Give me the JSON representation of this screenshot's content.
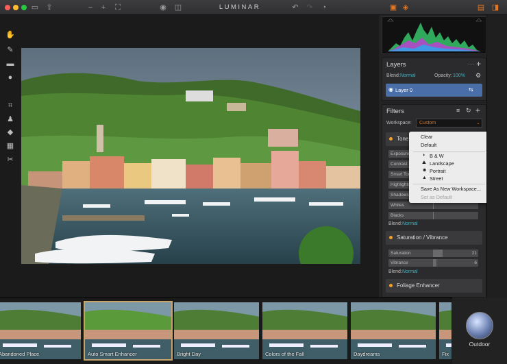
{
  "app": {
    "title": "LUMINAR"
  },
  "layers": {
    "title": "Layers",
    "blend_label": "Blend:",
    "blend_value": "Normal",
    "opacity_label": "Opacity:",
    "opacity_value": "100%",
    "layer_name": "Layer 0"
  },
  "filters": {
    "title": "Filters",
    "workspace_label": "Workspace:",
    "workspace_value": "Custom",
    "tone": {
      "title": "Tone",
      "rows": [
        "Exposure",
        "Contrast",
        "Smart Tone",
        "Highlights",
        "Shadows",
        "Whites",
        "Blacks"
      ],
      "blend_label": "Blend:",
      "blend_value": "Normal"
    },
    "saturation": {
      "title": "Saturation / Vibrance",
      "saturation_label": "Saturation",
      "saturation_value": "21",
      "vibrance_label": "Vibrance",
      "vibrance_value": "6",
      "blend_label": "Blend:",
      "blend_value": "Normal"
    },
    "foliage": {
      "title": "Foliage Enhancer"
    }
  },
  "workspace_menu": {
    "items": [
      {
        "label": "Clear",
        "enabled": true
      },
      {
        "label": "Default",
        "enabled": true
      },
      {
        "label": "B & W",
        "enabled": true,
        "icon": "half-circle-icon"
      },
      {
        "label": "Landscape",
        "enabled": true,
        "icon": "mountain-icon"
      },
      {
        "label": "Portrait",
        "enabled": true,
        "icon": "face-icon"
      },
      {
        "label": "Street",
        "enabled": true,
        "icon": "building-icon"
      },
      {
        "label": "Save As New Workspace...",
        "enabled": true
      },
      {
        "label": "Set as Default",
        "enabled": false
      }
    ]
  },
  "presets": {
    "items": [
      "Abandoned Place",
      "Auto Smart Enhancer",
      "Bright Day",
      "Colors of the Fall",
      "Daydreams",
      "Fix"
    ],
    "selected": "Auto Smart Enhancer",
    "category": "Outdoor"
  },
  "colors": {
    "accent": "#43b0c0",
    "orange": "#e8761e",
    "highlight": "#4a7bd0"
  }
}
